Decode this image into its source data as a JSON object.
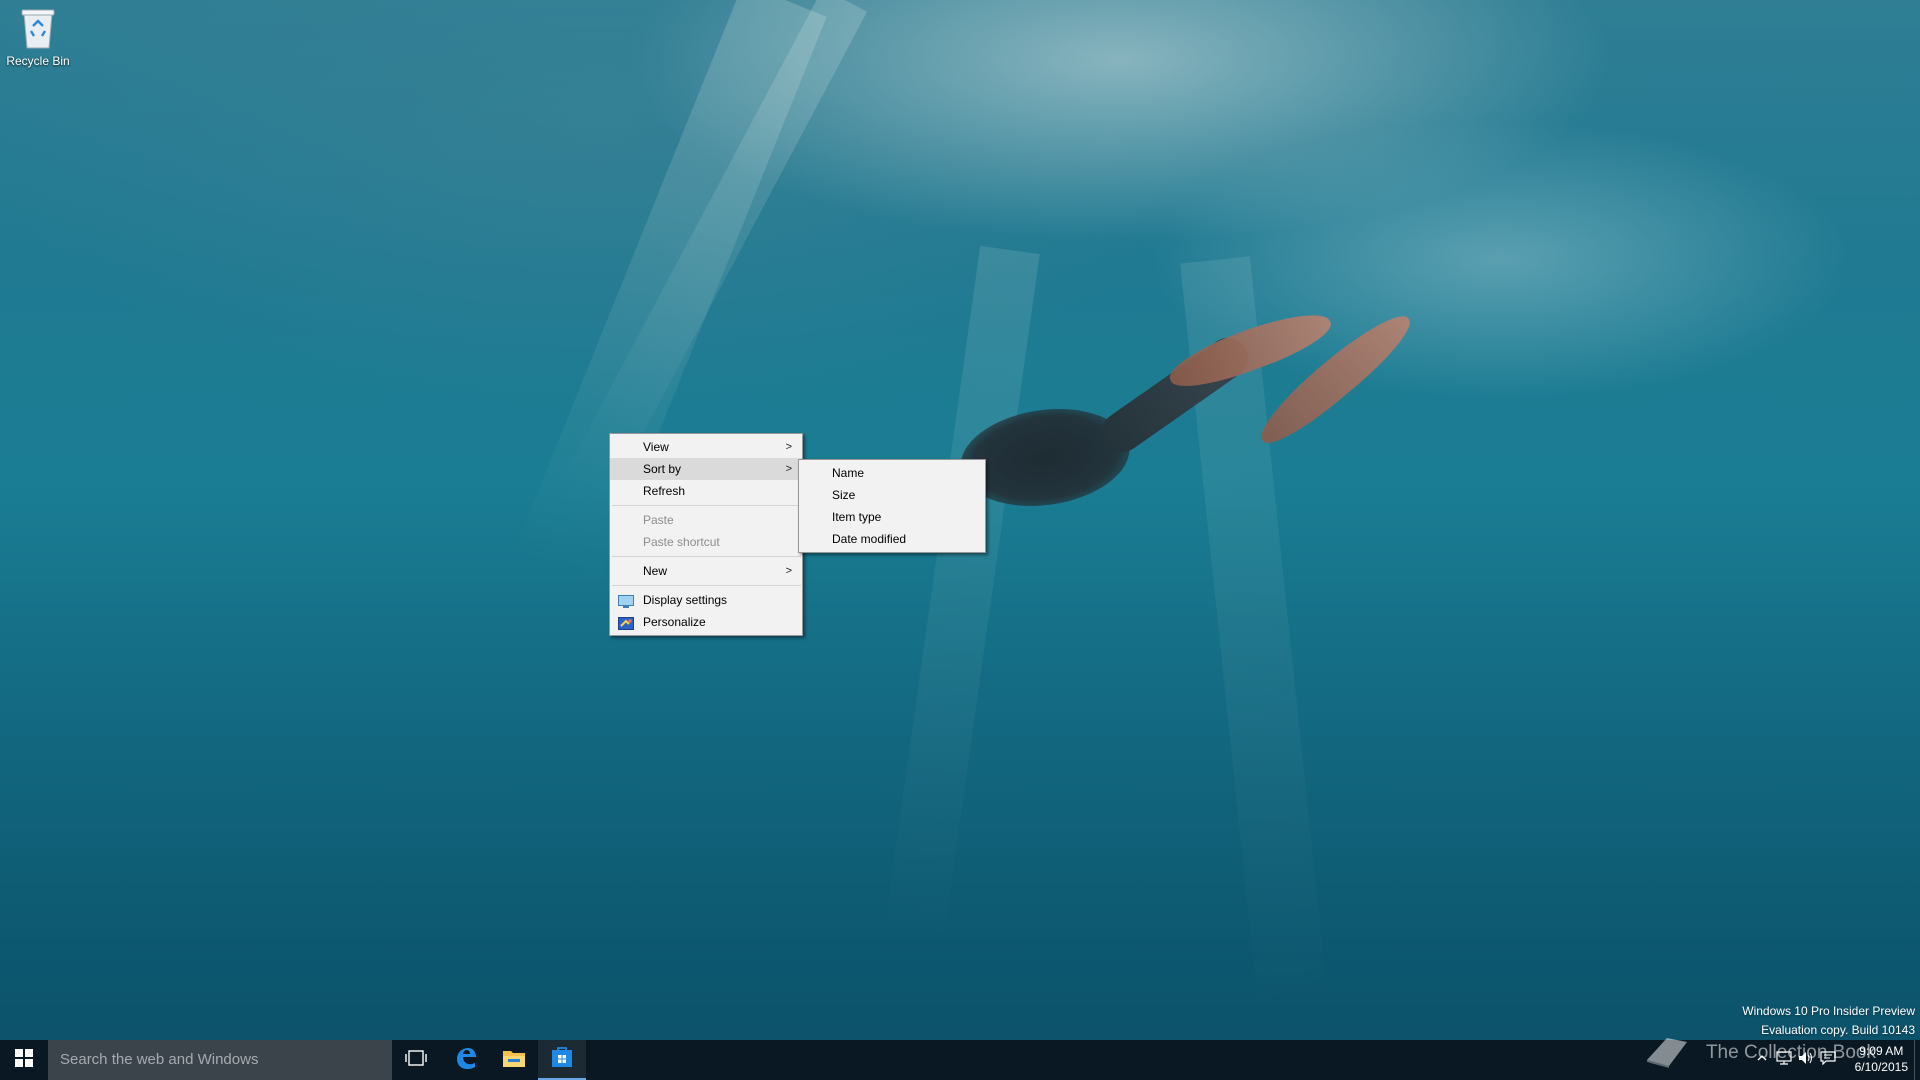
{
  "desktop": {
    "recycle_bin_label": "Recycle Bin"
  },
  "context_menu": {
    "items": [
      {
        "label": "View",
        "has_submenu": true
      },
      {
        "label": "Sort by",
        "has_submenu": true,
        "highlighted": true
      },
      {
        "label": "Refresh"
      },
      {
        "label": "Paste",
        "disabled": true
      },
      {
        "label": "Paste shortcut",
        "disabled": true
      },
      {
        "label": "New",
        "has_submenu": true
      },
      {
        "label": "Display settings",
        "icon": "display-icon"
      },
      {
        "label": "Personalize",
        "icon": "personalize-icon"
      }
    ],
    "arrow_glyph": ">"
  },
  "sort_submenu": {
    "items": [
      {
        "label": "Name"
      },
      {
        "label": "Size"
      },
      {
        "label": "Item type"
      },
      {
        "label": "Date modified"
      }
    ]
  },
  "watermark": {
    "line1": "Windows 10 Pro Insider Preview",
    "line2": "Evaluation copy. Build 10143"
  },
  "taskbar": {
    "search_placeholder": "Search the web and Windows",
    "icons": [
      "windows-logo-icon",
      "task-view-icon",
      "edge-icon",
      "file-explorer-icon",
      "store-icon"
    ],
    "tray_icons": [
      "chevron-up-icon",
      "network-icon",
      "volume-icon",
      "action-center-icon"
    ],
    "time": "9:09 AM",
    "date": "6/10/2015",
    "overlay_text": "The Collection Book"
  },
  "colors": {
    "taskbar": "#0a141c",
    "menu_bg": "#f2f2f2",
    "menu_highlight": "#dadada",
    "accent": "#1e88e5"
  }
}
